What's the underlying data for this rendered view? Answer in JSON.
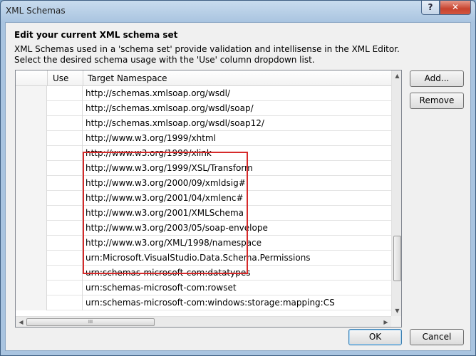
{
  "window": {
    "title": "XML Schemas",
    "help_label": "?",
    "close_label": "✕"
  },
  "heading": "Edit your current XML schema set",
  "description": [
    "XML Schemas used in a 'schema set' provide validation and intellisense in the XML Editor.",
    "Select the desired schema usage with the 'Use' column dropdown list."
  ],
  "grid": {
    "columns": [
      "Use",
      "Target Namespace"
    ],
    "rows": [
      "http://schemas.xmlsoap.org/wsdl/",
      "http://schemas.xmlsoap.org/wsdl/soap/",
      "http://schemas.xmlsoap.org/wsdl/soap12/",
      "http://www.w3.org/1999/xhtml",
      "http://www.w3.org/1999/xlink",
      "http://www.w3.org/1999/XSL/Transform",
      "http://www.w3.org/2000/09/xmldsig#",
      "http://www.w3.org/2001/04/xmlenc#",
      "http://www.w3.org/2001/XMLSchema",
      "http://www.w3.org/2003/05/soap-envelope",
      "http://www.w3.org/XML/1998/namespace",
      "urn:Microsoft.VisualStudio.Data.Schema.Permissions",
      "urn:schemas-microsoft-com:datatypes",
      "urn:schemas-microsoft-com:rowset",
      "urn:schemas-microsoft-com:windows:storage:mapping:CS"
    ],
    "hscroll_grip": "III"
  },
  "buttons": {
    "add": "Add...",
    "remove": "Remove",
    "ok": "OK",
    "cancel": "Cancel"
  },
  "colors": {
    "highlight": "#d62a2a",
    "title_bar": "#a9c4e0",
    "close": "#c7432f"
  }
}
